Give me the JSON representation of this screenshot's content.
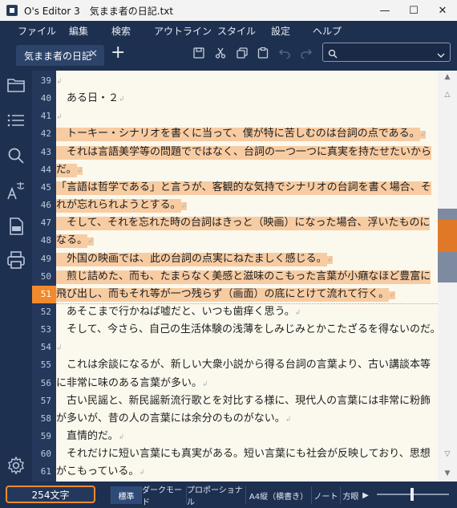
{
  "window": {
    "app_title": "O's Editor 3　気まま者の日記.txt",
    "minimize": "—",
    "maximize": "☐",
    "close": "✕"
  },
  "menu": [
    "ファイル",
    "編集",
    "検索",
    "アウトライン",
    "スタイル",
    "設定",
    "ヘルプ"
  ],
  "tab": {
    "label": "気まま者の日記",
    "close": "✕",
    "add": "+"
  },
  "search": {
    "value": "",
    "placeholder": ""
  },
  "editor": {
    "current_line": "51",
    "lines": [
      {
        "n": "39",
        "text": "",
        "selected": false
      },
      {
        "n": "40",
        "text": "　ある日・２",
        "selected": false
      },
      {
        "n": "41",
        "text": "",
        "selected": false
      },
      {
        "n": "42",
        "text": "　トーキー・シナリオを書くに当って、僕が特に苦しむのは台詞の点である。",
        "selected": true
      },
      {
        "n": "43",
        "text": "　それは言語美学等の問題でではなく、台詞の一つ一つに真実を持たせたいから",
        "selected": true,
        "cont": true
      },
      {
        "n": "44",
        "text": "だ。",
        "selected": true
      },
      {
        "n": "45",
        "text": "「言語は哲学である」と言うが、客観的な気持でシナリオの台詞を書く場合、そ",
        "selected": true,
        "cont": true
      },
      {
        "n": "46",
        "text": "れが忘れられようとする。",
        "selected": true
      },
      {
        "n": "47",
        "text": "　そして、それを忘れた時の台詞はきっと（映画）になった場合、浮いたものに",
        "selected": true,
        "cont": true
      },
      {
        "n": "48",
        "text": "なる。",
        "selected": true
      },
      {
        "n": "49",
        "text": "　外国の映画では、此の台詞の点実にねたましく感じる。",
        "selected": true
      },
      {
        "n": "50",
        "text": "　煎じ詰めた、而も、たまらなく美感と滋味のこもった言葉が小癪なほど豊富に",
        "selected": true,
        "cont": true
      },
      {
        "n": "51",
        "text": "飛び出し、而もそれ等が一つ残らず（画面）の底にとけて流れて行く。",
        "selected": true
      },
      {
        "n": "52",
        "text": "　あそこまで行かねば嘘だと、いつも歯痒く思う。",
        "selected": false
      },
      {
        "n": "53",
        "text": "　そして、今さら、自己の生活体験の浅薄をしみじみとかこたざるを得ないのだ。",
        "selected": false
      },
      {
        "n": "54",
        "text": "",
        "selected": false
      },
      {
        "n": "55",
        "text": "　これは余談になるが、新しい大衆小説から得る台詞の言葉より、古い講談本等",
        "selected": false,
        "cont": true
      },
      {
        "n": "56",
        "text": "に非常に味のある言葉が多い。",
        "selected": false
      },
      {
        "n": "57",
        "text": "　古い民謡と、新民謡新流行歌とを対比する様に、現代人の言葉には非常に粉飾",
        "selected": false,
        "cont": true
      },
      {
        "n": "58",
        "text": "が多いが、昔の人の言葉には余分のものがない。",
        "selected": false
      },
      {
        "n": "59",
        "text": "　直情的だ。",
        "selected": false
      },
      {
        "n": "60",
        "text": "　それだけに短い言葉にも真実がある。短い言葉にも社会が反映しており、思想",
        "selected": false,
        "cont": true
      },
      {
        "n": "61",
        "text": "がこもっている。",
        "selected": false
      }
    ]
  },
  "status": {
    "char_count": "254文字",
    "modes": [
      "標準",
      "ダークモード",
      "プロポーショナル",
      "A4縦（横書き）",
      "ノート",
      "方眼"
    ],
    "active_mode": "標準",
    "more_arrow": "▶"
  },
  "colors": {
    "accent": "#f28a2d",
    "selection": "#f8cca3",
    "background": "#1e3050",
    "editor_bg": "#fbf9ee"
  },
  "icons": {
    "sidebar": [
      "folder-icon",
      "list-icon",
      "search-icon",
      "text-style-icon",
      "pdf-icon",
      "print-icon",
      "settings-icon"
    ],
    "toolbar": [
      "save-icon",
      "cut-icon",
      "copy-icon",
      "paste-icon",
      "undo-icon",
      "redo-icon"
    ]
  }
}
